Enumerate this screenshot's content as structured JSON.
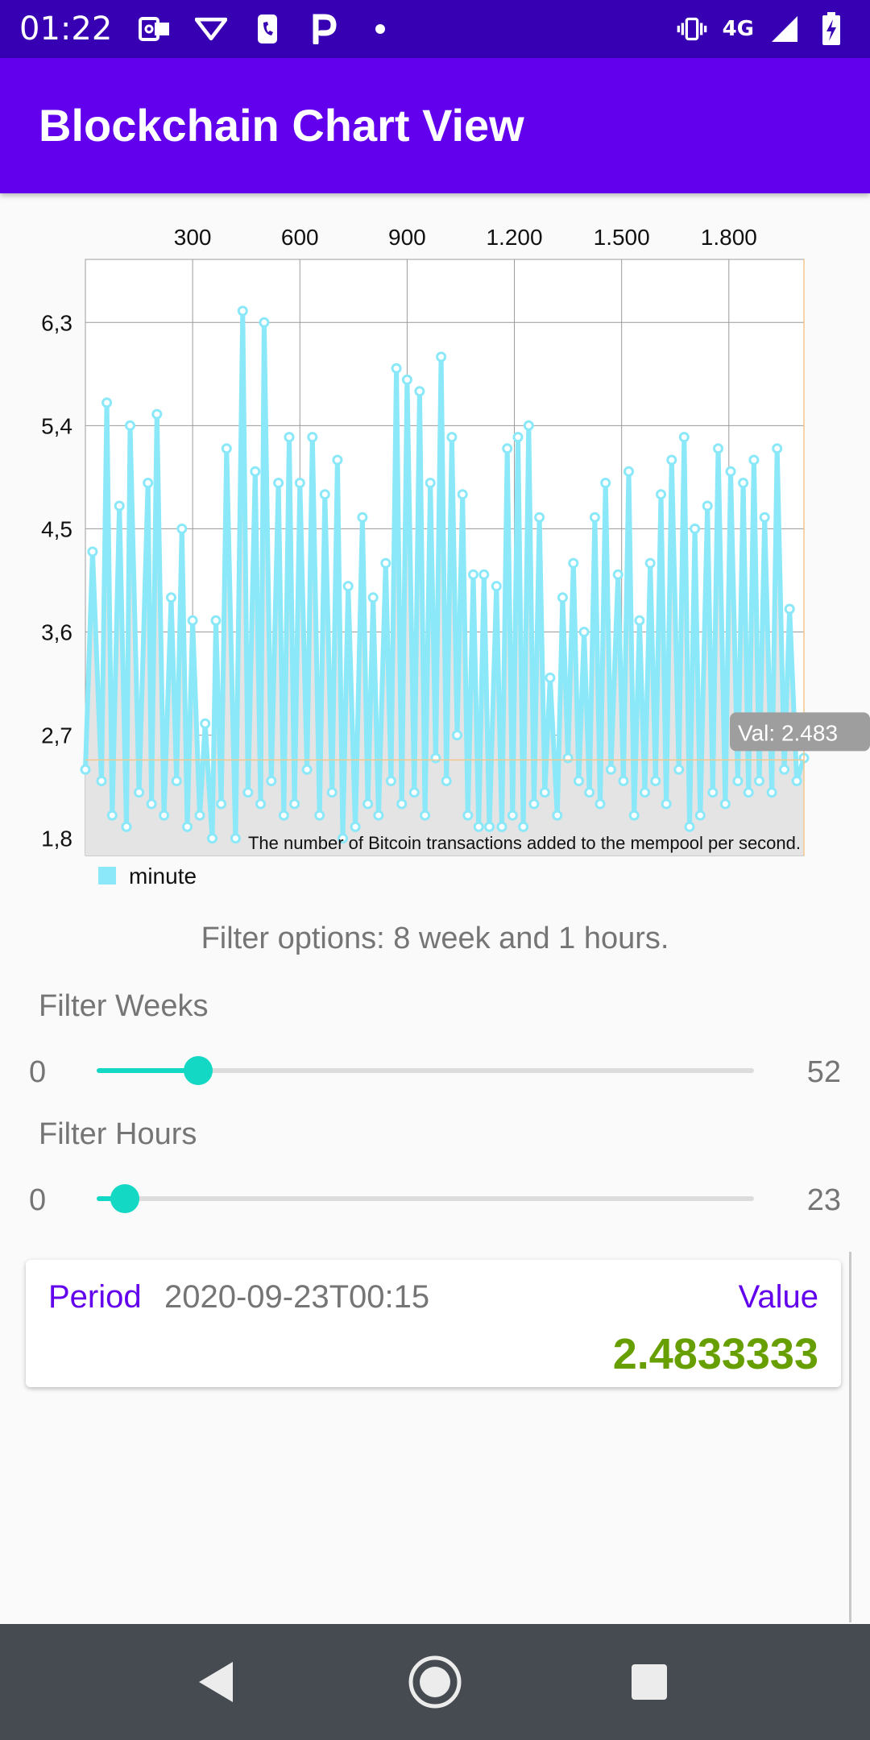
{
  "status_bar": {
    "time": "01:22",
    "network": "4G",
    "left_icons": [
      "outlook-icon",
      "vivo-icon",
      "phone-icon",
      "parking-icon",
      "dot-icon"
    ],
    "right_icons": [
      "vibrate-icon",
      "signal-icon",
      "battery-charging-icon"
    ]
  },
  "app_bar": {
    "title": "Blockchain Chart View"
  },
  "chart_data": {
    "type": "line",
    "title": "",
    "description": "The number of Bitcoin transactions added to the mempool per second.",
    "xlabel": "",
    "ylabel": "",
    "x_tick_labels": [
      "300",
      "600",
      "900",
      "1.200",
      "1.500",
      "1.800"
    ],
    "x_ticks": [
      300,
      600,
      900,
      1200,
      1500,
      1800
    ],
    "xlim": [
      0,
      2010
    ],
    "y_tick_labels": [
      "1,8",
      "2,7",
      "3,6",
      "4,5",
      "5,4",
      "6,3"
    ],
    "y_ticks": [
      1.8,
      2.7,
      3.6,
      4.5,
      5.4,
      6.3
    ],
    "ylim": [
      1.65,
      6.85
    ],
    "grid": true,
    "x_axis_position": "top",
    "legend": {
      "position": "bottom-left",
      "entries": [
        "minute"
      ]
    },
    "series_color": "#8ae8f8",
    "highlight": {
      "x": 2010,
      "y": 2.4833333,
      "label": "Val: 2.483"
    },
    "series": [
      {
        "name": "minute",
        "x": [
          0,
          20,
          45,
          60,
          75,
          95,
          115,
          125,
          150,
          175,
          185,
          200,
          220,
          240,
          255,
          270,
          285,
          300,
          320,
          335,
          355,
          365,
          380,
          395,
          420,
          440,
          455,
          475,
          490,
          500,
          520,
          540,
          555,
          570,
          585,
          600,
          620,
          635,
          655,
          670,
          690,
          705,
          720,
          735,
          755,
          775,
          790,
          805,
          820,
          840,
          855,
          870,
          885,
          900,
          920,
          935,
          950,
          965,
          980,
          995,
          1010,
          1025,
          1040,
          1055,
          1070,
          1085,
          1100,
          1115,
          1130,
          1150,
          1165,
          1180,
          1195,
          1210,
          1225,
          1240,
          1255,
          1270,
          1285,
          1300,
          1320,
          1335,
          1350,
          1365,
          1380,
          1395,
          1410,
          1425,
          1440,
          1455,
          1470,
          1490,
          1505,
          1520,
          1535,
          1550,
          1565,
          1580,
          1595,
          1610,
          1625,
          1640,
          1660,
          1675,
          1690,
          1705,
          1720,
          1740,
          1755,
          1770,
          1790,
          1805,
          1825,
          1840,
          1855,
          1870,
          1885,
          1900,
          1920,
          1935,
          1955,
          1970,
          1990,
          2010
        ],
        "values": [
          2.4,
          4.3,
          2.3,
          5.6,
          2.0,
          4.7,
          1.9,
          5.4,
          2.2,
          4.9,
          2.1,
          5.5,
          2.0,
          3.9,
          2.3,
          4.5,
          1.9,
          3.7,
          2.0,
          2.8,
          1.8,
          3.7,
          2.1,
          5.2,
          1.8,
          6.4,
          2.2,
          5.0,
          2.1,
          6.3,
          2.3,
          4.9,
          2.0,
          5.3,
          2.1,
          4.9,
          2.4,
          5.3,
          2.0,
          4.8,
          2.2,
          5.1,
          1.8,
          4.0,
          1.9,
          4.6,
          2.1,
          3.9,
          2.0,
          4.2,
          2.3,
          5.9,
          2.1,
          5.8,
          2.2,
          5.7,
          2.0,
          4.9,
          2.5,
          6.0,
          2.3,
          5.3,
          2.7,
          4.8,
          2.0,
          4.1,
          1.9,
          4.1,
          1.9,
          4.0,
          1.9,
          5.2,
          2.0,
          5.3,
          1.9,
          5.4,
          2.1,
          4.6,
          2.2,
          3.2,
          2.0,
          3.9,
          2.5,
          4.2,
          2.3,
          3.6,
          2.2,
          4.6,
          2.1,
          4.9,
          2.4,
          4.1,
          2.3,
          5.0,
          2.0,
          3.7,
          2.2,
          4.2,
          2.3,
          4.8,
          2.1,
          5.1,
          2.4,
          5.3,
          1.9,
          4.5,
          2.0,
          4.7,
          2.2,
          5.2,
          2.1,
          5.0,
          2.3,
          4.9,
          2.2,
          5.1,
          2.3,
          4.6,
          2.2,
          5.2,
          2.4,
          3.8,
          2.3,
          2.5
        ]
      }
    ]
  },
  "filters": {
    "summary": "Filter options: 8 week and 1 hours.",
    "weeks": {
      "label": "Filter Weeks",
      "min_label": "0",
      "max_label": "52",
      "min": 0,
      "max": 52,
      "value": 8
    },
    "hours": {
      "label": "Filter Hours",
      "min_label": "0",
      "max_label": "23",
      "min": 0,
      "max": 23,
      "value": 1
    }
  },
  "card": {
    "period_label": "Period",
    "period_value": "2020-09-23T00:15",
    "value_label": "Value",
    "value": "2.4833333"
  },
  "nav_bar": {
    "buttons": [
      "back-icon",
      "home-icon",
      "recents-icon"
    ]
  }
}
